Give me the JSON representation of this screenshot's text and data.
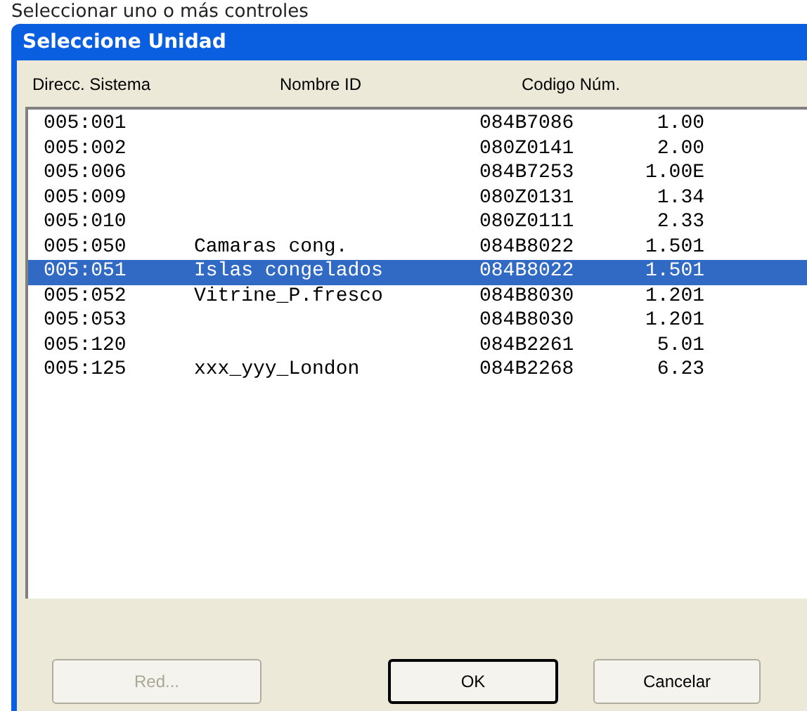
{
  "caption": "Seleccionar uno o más controles",
  "window": {
    "title": "Seleccione Unidad"
  },
  "columns": [
    "Direcc. Sistema",
    "Nombre ID",
    "Codigo Núm."
  ],
  "rows": [
    {
      "address": "005:001",
      "name": "",
      "code": "084B7086",
      "version": "1.00",
      "selected": false
    },
    {
      "address": "005:002",
      "name": "",
      "code": "080Z0141",
      "version": "2.00",
      "selected": false
    },
    {
      "address": "005:006",
      "name": "",
      "code": "084B7253",
      "version": "1.00E",
      "selected": false
    },
    {
      "address": "005:009",
      "name": "",
      "code": "080Z0131",
      "version": "1.34",
      "selected": false
    },
    {
      "address": "005:010",
      "name": "",
      "code": "080Z0111",
      "version": "2.33",
      "selected": false
    },
    {
      "address": "005:050",
      "name": "Camaras cong.",
      "code": "084B8022",
      "version": "1.501",
      "selected": false
    },
    {
      "address": "005:051",
      "name": "Islas congelados",
      "code": "084B8022",
      "version": "1.501",
      "selected": true
    },
    {
      "address": "005:052",
      "name": "Vitrine_P.fresco",
      "code": "084B8030",
      "version": "1.201",
      "selected": false
    },
    {
      "address": "005:053",
      "name": "",
      "code": "084B8030",
      "version": "1.201",
      "selected": false
    },
    {
      "address": "005:120",
      "name": "",
      "code": "084B2261",
      "version": "5.01",
      "selected": false
    },
    {
      "address": "005:125",
      "name": "xxx_yyy_London",
      "code": "084B2268",
      "version": "6.23",
      "selected": false
    }
  ],
  "buttons": [
    {
      "label": "Red...",
      "disabled": true,
      "default": false
    },
    {
      "label": "OK",
      "disabled": false,
      "default": true
    },
    {
      "label": "Cancelar",
      "disabled": false,
      "default": false
    }
  ]
}
